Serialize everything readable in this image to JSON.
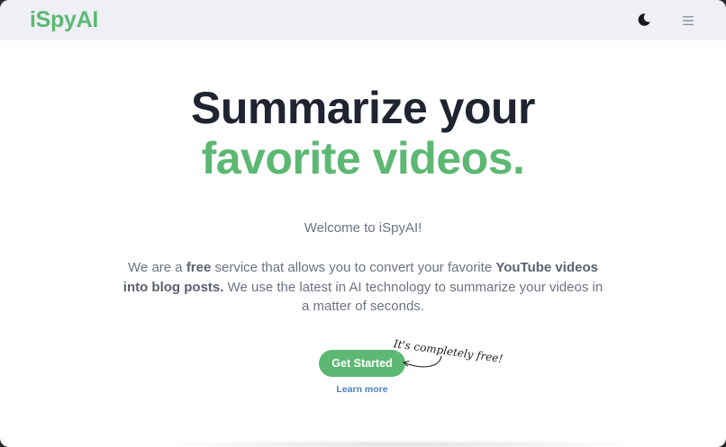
{
  "navbar": {
    "logo": "iSpyAI",
    "theme_toggle_icon": "moon-icon",
    "menu_icon": "hamburger-menu-icon"
  },
  "hero": {
    "title_line1": "Summarize your",
    "title_line2": "favorite videos.",
    "welcome": "Welcome to iSpyAI!",
    "description": {
      "part1": "We are a ",
      "bold1": "free",
      "part2": " service that allows you to convert your favorite ",
      "bold2": "YouTube videos into blog posts.",
      "part3": " We use the latest in AI technology to summarize your videos in a matter of seconds."
    }
  },
  "cta": {
    "button_label": "Get Started",
    "learn_more": "Learn more",
    "annotation": "It's completely free!",
    "arrow_icon": "curved-arrow-icon"
  },
  "colors": {
    "brand": "#5cb872",
    "heading": "#1f2430",
    "body_text": "#6b7382",
    "link": "#4a7fc1",
    "navbar_bg": "#eef0f5"
  }
}
